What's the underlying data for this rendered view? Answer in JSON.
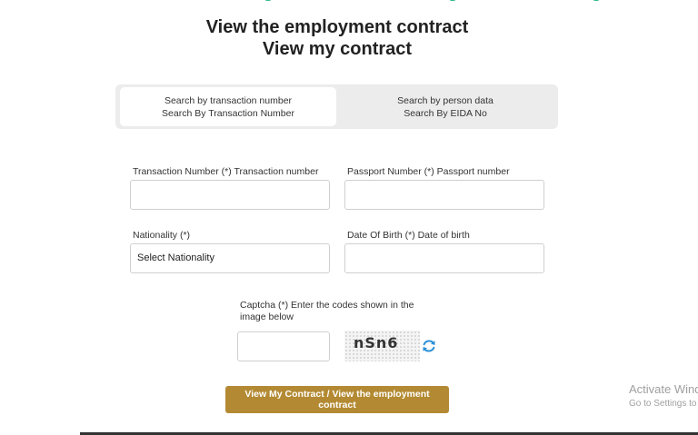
{
  "page": {
    "title_line1": "View the employment contract",
    "title_line2": "View my contract"
  },
  "tabs": [
    {
      "line1": "Search by transaction number",
      "line2": "Search By Transaction Number",
      "active": true
    },
    {
      "line1": "Search by person data",
      "line2": "Search By EIDA No",
      "active": false
    }
  ],
  "form": {
    "transaction_label": "Transaction Number (*) Transaction number",
    "transaction_value": "",
    "passport_label": "Passport Number (*) Passport number",
    "passport_value": "",
    "nationality_label": "Nationality (*)",
    "nationality_selected": "Select Nationality",
    "dob_label": "Date Of Birth (*) Date of birth",
    "dob_value": "",
    "captcha_label": "Captcha (*) Enter the codes shown in the image below",
    "captcha_value": "",
    "captcha_code": "nSn6",
    "submit_label": "View My Contract / View the employment contract"
  },
  "watermark": {
    "line1": "Activate Wind",
    "line2": "Go to Settings to"
  },
  "colors": {
    "accent": "#b38a33",
    "refresh_icon": "#2a8fd6",
    "tab_bg": "#ececec"
  },
  "icons": {
    "refresh": "refresh-icon"
  }
}
